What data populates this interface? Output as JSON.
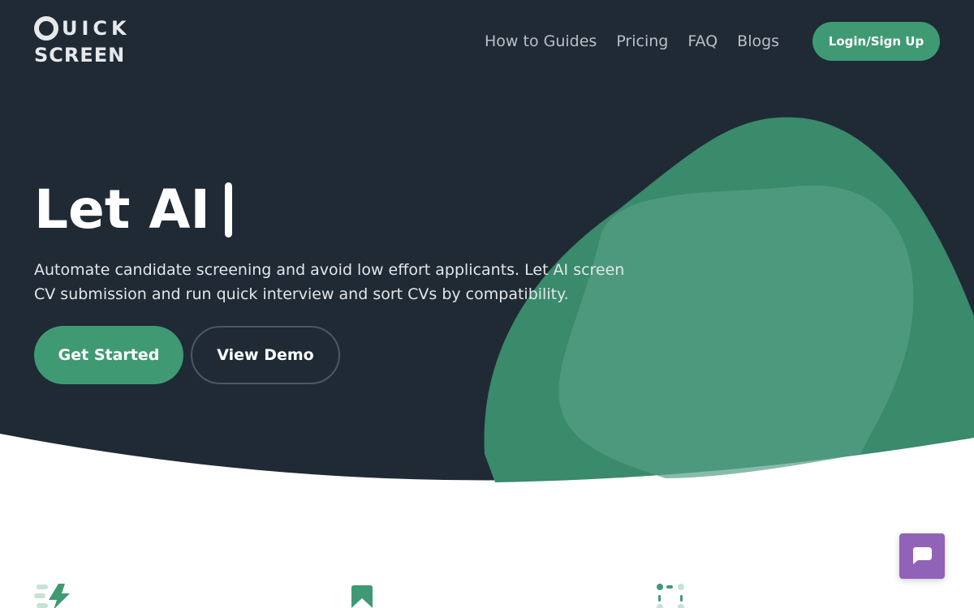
{
  "brand": {
    "line1": "UICK",
    "line2": "SCREEN"
  },
  "nav": [
    {
      "label": "How to Guides"
    },
    {
      "label": "Pricing"
    },
    {
      "label": "FAQ"
    },
    {
      "label": "Blogs"
    }
  ],
  "login_label": "Login/Sign Up",
  "hero": {
    "title": "Let AI",
    "description": "Automate candidate screening and avoid low effort applicants. Let AI screen CV submission and run quick interview and sort CVs by compatibility.",
    "primary": "Get Started",
    "secondary": "View Demo"
  },
  "features": [
    {
      "icon": "lightning-icon"
    },
    {
      "icon": "bookmark-icon"
    },
    {
      "icon": "dashed-grid-icon"
    }
  ],
  "colors": {
    "background": "#1f2a35",
    "accent": "#3f9a74",
    "chat": "#9163b8"
  }
}
